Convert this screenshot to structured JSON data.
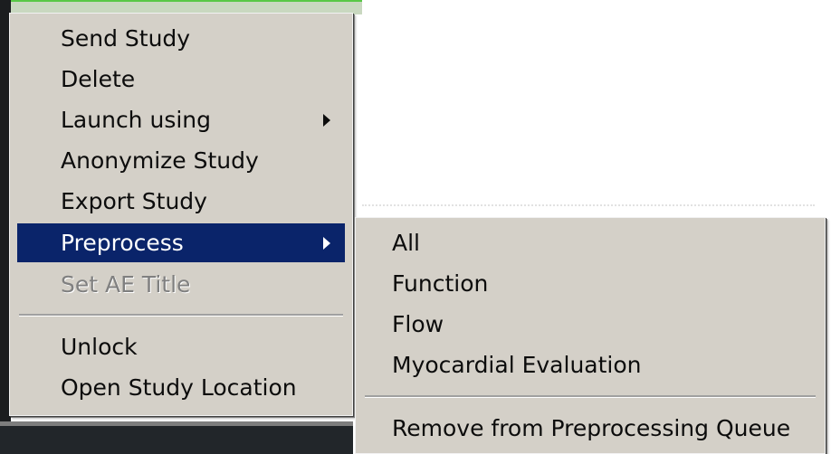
{
  "context_menu": {
    "items": [
      {
        "label": "Send Study"
      },
      {
        "label": "Delete"
      },
      {
        "label": "Launch using",
        "submenu": true
      },
      {
        "label": "Anonymize Study"
      },
      {
        "label": "Export Study"
      },
      {
        "label": "Preprocess",
        "submenu": true,
        "selected": true
      },
      {
        "label": "Set AE Title",
        "disabled": true
      },
      {
        "label": "Unlock"
      },
      {
        "label": "Open Study Location"
      }
    ]
  },
  "submenu": {
    "parent": "Preprocess",
    "items": [
      {
        "label": "All"
      },
      {
        "label": "Function"
      },
      {
        "label": "Flow"
      },
      {
        "label": "Myocardial Evaluation"
      },
      {
        "label": "Remove from Preprocessing Queue"
      }
    ]
  },
  "colors": {
    "menu_bg": "#d4d0c8",
    "highlight": "#0a246a",
    "disabled_text": "#808080"
  },
  "icons": {
    "submenu_indicator": "triangle-right-icon"
  }
}
